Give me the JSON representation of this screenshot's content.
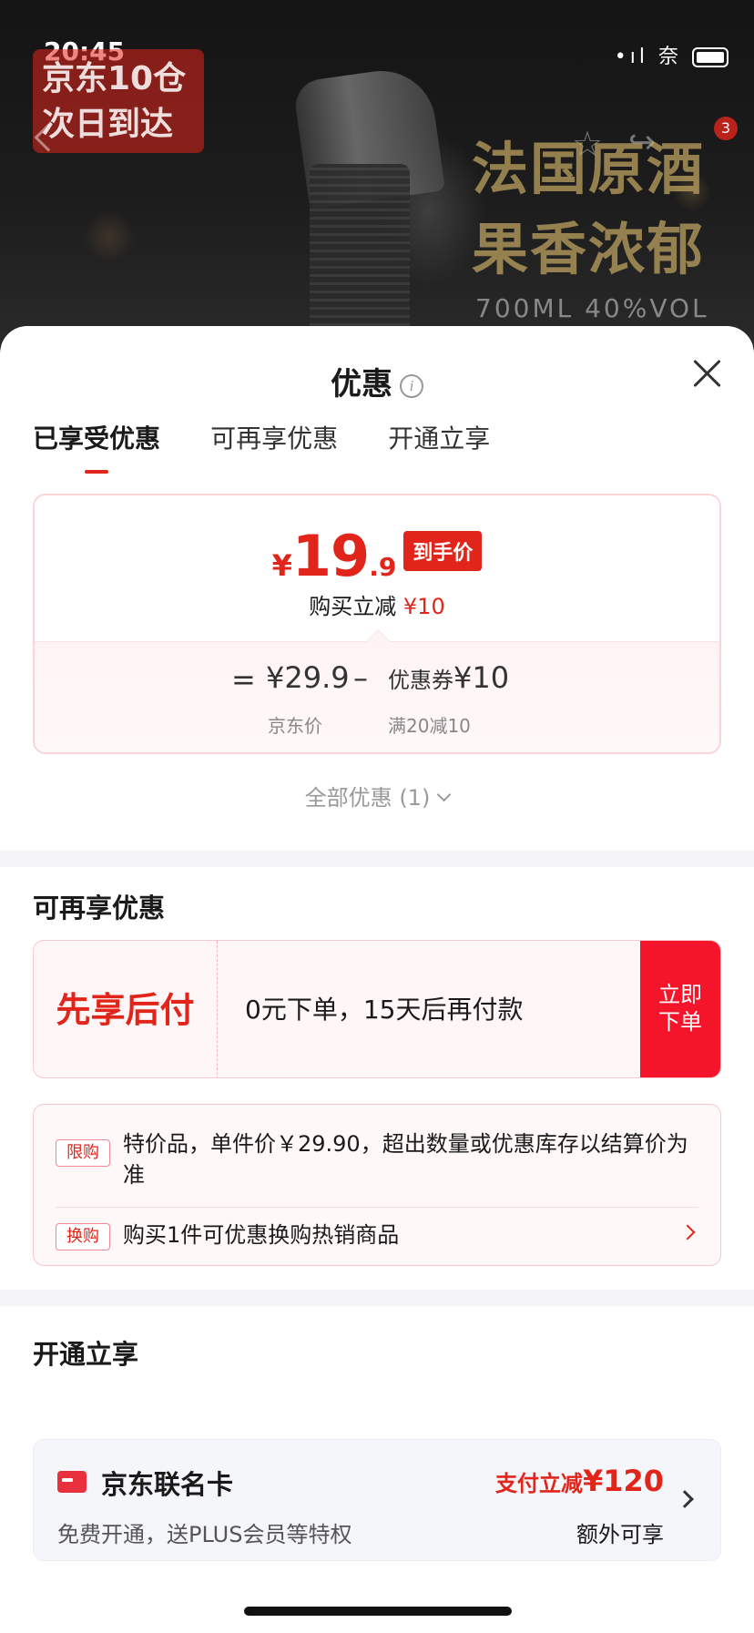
{
  "status_bar": {
    "time": "20:45",
    "signal": "•ıl",
    "wifi": "奈"
  },
  "banner": {
    "promo_line1": "京东10仓",
    "promo_line2": "次日到达",
    "slogan_line1": "法国原酒",
    "slogan_line2": "果香浓郁",
    "spec": "700ML  40%VOL",
    "cart_count": "3",
    "fav_glyph": "☆",
    "share_glyph": "↪"
  },
  "sheet": {
    "title": "优惠",
    "info_glyph": "i",
    "tabs": [
      {
        "label": "已享受优惠",
        "active": true
      },
      {
        "label": "可再享优惠",
        "active": false
      },
      {
        "label": "开通立享",
        "active": false
      }
    ]
  },
  "price_card": {
    "currency": "¥",
    "price_integer": "19",
    "price_decimal": ".9",
    "final_badge": "到手价",
    "instant_label": "购买立减",
    "instant_amount": "¥10",
    "equals": "=",
    "minus": "–",
    "jd_price": "¥29.9",
    "jd_label": "京东价",
    "coupon_prefix": "优惠券",
    "coupon_amount": "¥10",
    "coupon_rule": "满20减10"
  },
  "all_discounts": "全部优惠 (1)",
  "reusable_section": {
    "title": "可再享优惠",
    "pay_later_name": "先享后付",
    "pay_later_desc": "0元下单，15天后再付款",
    "order_button_line1": "立即",
    "order_button_line2": "下单"
  },
  "rules": [
    {
      "tag": "限购",
      "text": "特价品，单件价￥29.90，超出数量或优惠库存以结算价为准"
    },
    {
      "tag": "换购",
      "text": "购买1件可优惠换购热销商品"
    }
  ],
  "open_section": {
    "title": "开通立享",
    "card_name": "京东联名卡",
    "card_desc": "免费开通，送PLUS会员等特权",
    "discount_prefix": "支付立减",
    "discount_amount": "¥120",
    "extra": "额外可享"
  },
  "colors": {
    "accent": "#e1251b",
    "pay_button": "#f5152a",
    "card_bg": "#f5f6fa"
  }
}
